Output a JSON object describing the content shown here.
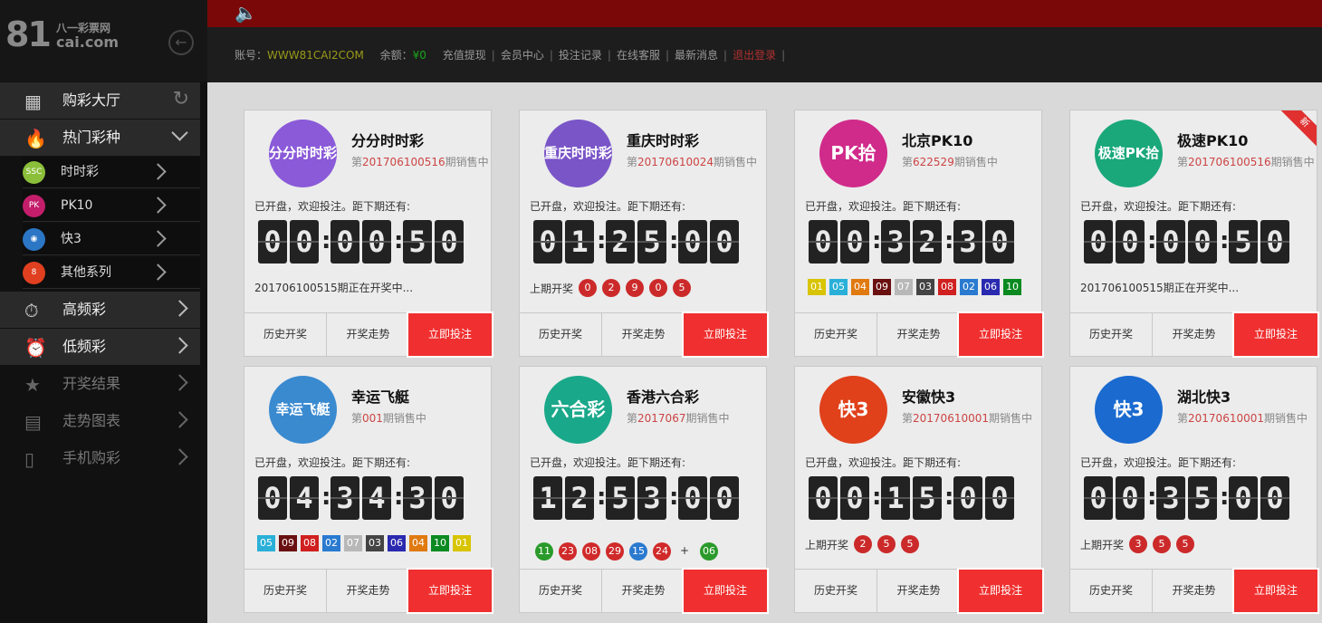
{
  "logo": {
    "num": "81",
    "cn": "八一彩票网",
    "en": "cai.com"
  },
  "sidebar": {
    "items": [
      {
        "label": "购彩大厅"
      },
      {
        "label": "热门彩种"
      },
      {
        "label": "高频彩"
      },
      {
        "label": "低频彩"
      },
      {
        "label": "开奖结果"
      },
      {
        "label": "走势图表"
      },
      {
        "label": "手机购彩"
      }
    ],
    "sub": [
      {
        "label": "时时彩",
        "color": "#8bbf3a"
      },
      {
        "label": "PK10",
        "color": "#c41e6b"
      },
      {
        "label": "快3",
        "color": "#2b76c5"
      },
      {
        "label": "其他系列",
        "color": "#e04020"
      }
    ]
  },
  "infobar": {
    "account_label": "账号：",
    "account": "WWW81CAI2COM",
    "balance_label": "余额：",
    "balance": "¥0",
    "links": [
      "充值提现",
      "会员中心",
      "投注记录",
      "在线客服",
      "最新消息"
    ],
    "logout": "退出登录",
    "trail": "|"
  },
  "common": {
    "hint": "已开盘，欢迎投注。距下期还有:",
    "history": "历史开奖",
    "trend": "开奖走势",
    "buy": "立即投注",
    "prev_label": "上期开奖",
    "issue_pre": "第",
    "issue_post": "期销售中",
    "plus": "+",
    "new_badge": "新"
  },
  "cards": [
    {
      "name": "分分时时彩",
      "logo_text": "分分时时彩",
      "logo_color": "#8a5ad8",
      "issue": "201706100516",
      "time": "00:00:50",
      "note": "201706100515期正在开奖中..."
    },
    {
      "name": "重庆时时彩",
      "logo_text": "重庆时时彩",
      "logo_color": "#7a55c8",
      "issue": "20170610024",
      "time": "01:25:00",
      "balls": [
        "0",
        "2",
        "9",
        "0",
        "5"
      ]
    },
    {
      "name": "北京PK10",
      "logo_text": "PK拾",
      "logo_color": "#d02a8a",
      "issue": "622529",
      "time": "00:32:30",
      "squares": [
        {
          "v": "01",
          "c": "#d8c400"
        },
        {
          "v": "05",
          "c": "#2ab0d8"
        },
        {
          "v": "04",
          "c": "#e07a10"
        },
        {
          "v": "09",
          "c": "#6a1010"
        },
        {
          "v": "07",
          "c": "#b8b8b8"
        },
        {
          "v": "03",
          "c": "#444444"
        },
        {
          "v": "08",
          "c": "#d02020"
        },
        {
          "v": "02",
          "c": "#2a7ad0"
        },
        {
          "v": "06",
          "c": "#2a2ab0"
        },
        {
          "v": "10",
          "c": "#0a8a20"
        }
      ]
    },
    {
      "name": "极速PK10",
      "logo_text": "极速PK拾",
      "logo_color": "#1aa87a",
      "issue": "201706100516",
      "time": "00:00:50",
      "note": "201706100515期正在开奖中...",
      "new": true
    },
    {
      "name": "幸运飞艇",
      "logo_text": "幸运飞艇",
      "logo_color": "#3a8ad0",
      "issue": "001",
      "time": "04:34:30",
      "squares": [
        {
          "v": "05",
          "c": "#2ab0d8"
        },
        {
          "v": "09",
          "c": "#6a1010"
        },
        {
          "v": "08",
          "c": "#d02020"
        },
        {
          "v": "02",
          "c": "#2a7ad0"
        },
        {
          "v": "07",
          "c": "#b8b8b8"
        },
        {
          "v": "03",
          "c": "#444444"
        },
        {
          "v": "06",
          "c": "#2a2ab0"
        },
        {
          "v": "04",
          "c": "#e07a10"
        },
        {
          "v": "10",
          "c": "#0a8a20"
        },
        {
          "v": "01",
          "c": "#d8c400"
        }
      ]
    },
    {
      "name": "香港六合彩",
      "logo_text": "六合彩",
      "logo_color": "#1aa88a",
      "issue": "2017067",
      "time": "12:53:00",
      "lhc": [
        {
          "v": "11",
          "c": "#2a9a2a"
        },
        {
          "v": "23",
          "c": "#d02a2a"
        },
        {
          "v": "08",
          "c": "#d02a2a"
        },
        {
          "v": "29",
          "c": "#d02a2a"
        },
        {
          "v": "15",
          "c": "#2a7ad0"
        },
        {
          "v": "24",
          "c": "#d02a2a"
        }
      ],
      "special": {
        "v": "06",
        "c": "#2a9a2a"
      }
    },
    {
      "name": "安徽快3",
      "logo_text": "快3",
      "logo_color": "#e0401a",
      "issue": "20170610001",
      "time": "00:15:00",
      "balls": [
        "2",
        "5",
        "5"
      ]
    },
    {
      "name": "湖北快3",
      "logo_text": "快3",
      "logo_color": "#1a6ad0",
      "issue": "20170610001",
      "time": "00:35:00",
      "balls": [
        "3",
        "5",
        "5"
      ]
    }
  ],
  "colors": {
    "topbar": "#7a0808",
    "buy": "#f03030",
    "overlay": "rgba(255,255,255,0.52)"
  }
}
